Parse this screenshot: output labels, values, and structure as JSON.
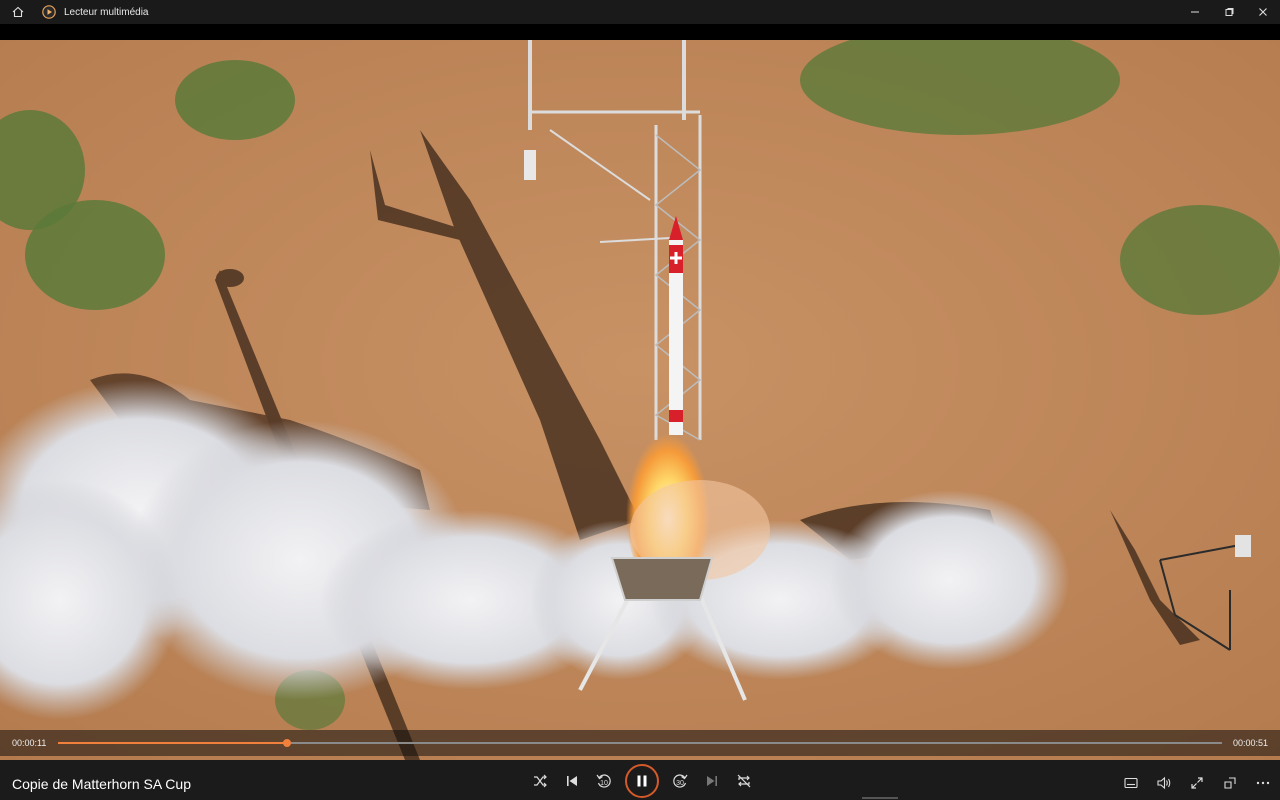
{
  "window": {
    "title": "Lecteur multimédia",
    "icons": {
      "home": "home-icon",
      "app": "media-player-icon",
      "minimize": "minimize-icon",
      "maximize": "maximize-icon",
      "close": "close-icon"
    }
  },
  "player": {
    "current_time": "00:00:11",
    "total_time": "00:00:51",
    "progress": 0.197,
    "accent_color": "#f0803c",
    "media_title": "Copie de Matterhorn SA Cup",
    "state": "playing",
    "controls": [
      "shuffle-icon",
      "previous-icon",
      "rewind-10-icon",
      "pause-icon",
      "forward-30-icon",
      "next-icon",
      "repeat-off-icon"
    ],
    "right_controls": [
      "subtitles-icon",
      "volume-icon",
      "fullscreen-icon",
      "mini-player-icon",
      "more-icon"
    ],
    "rewind_label": "10",
    "forward_label": "30"
  }
}
